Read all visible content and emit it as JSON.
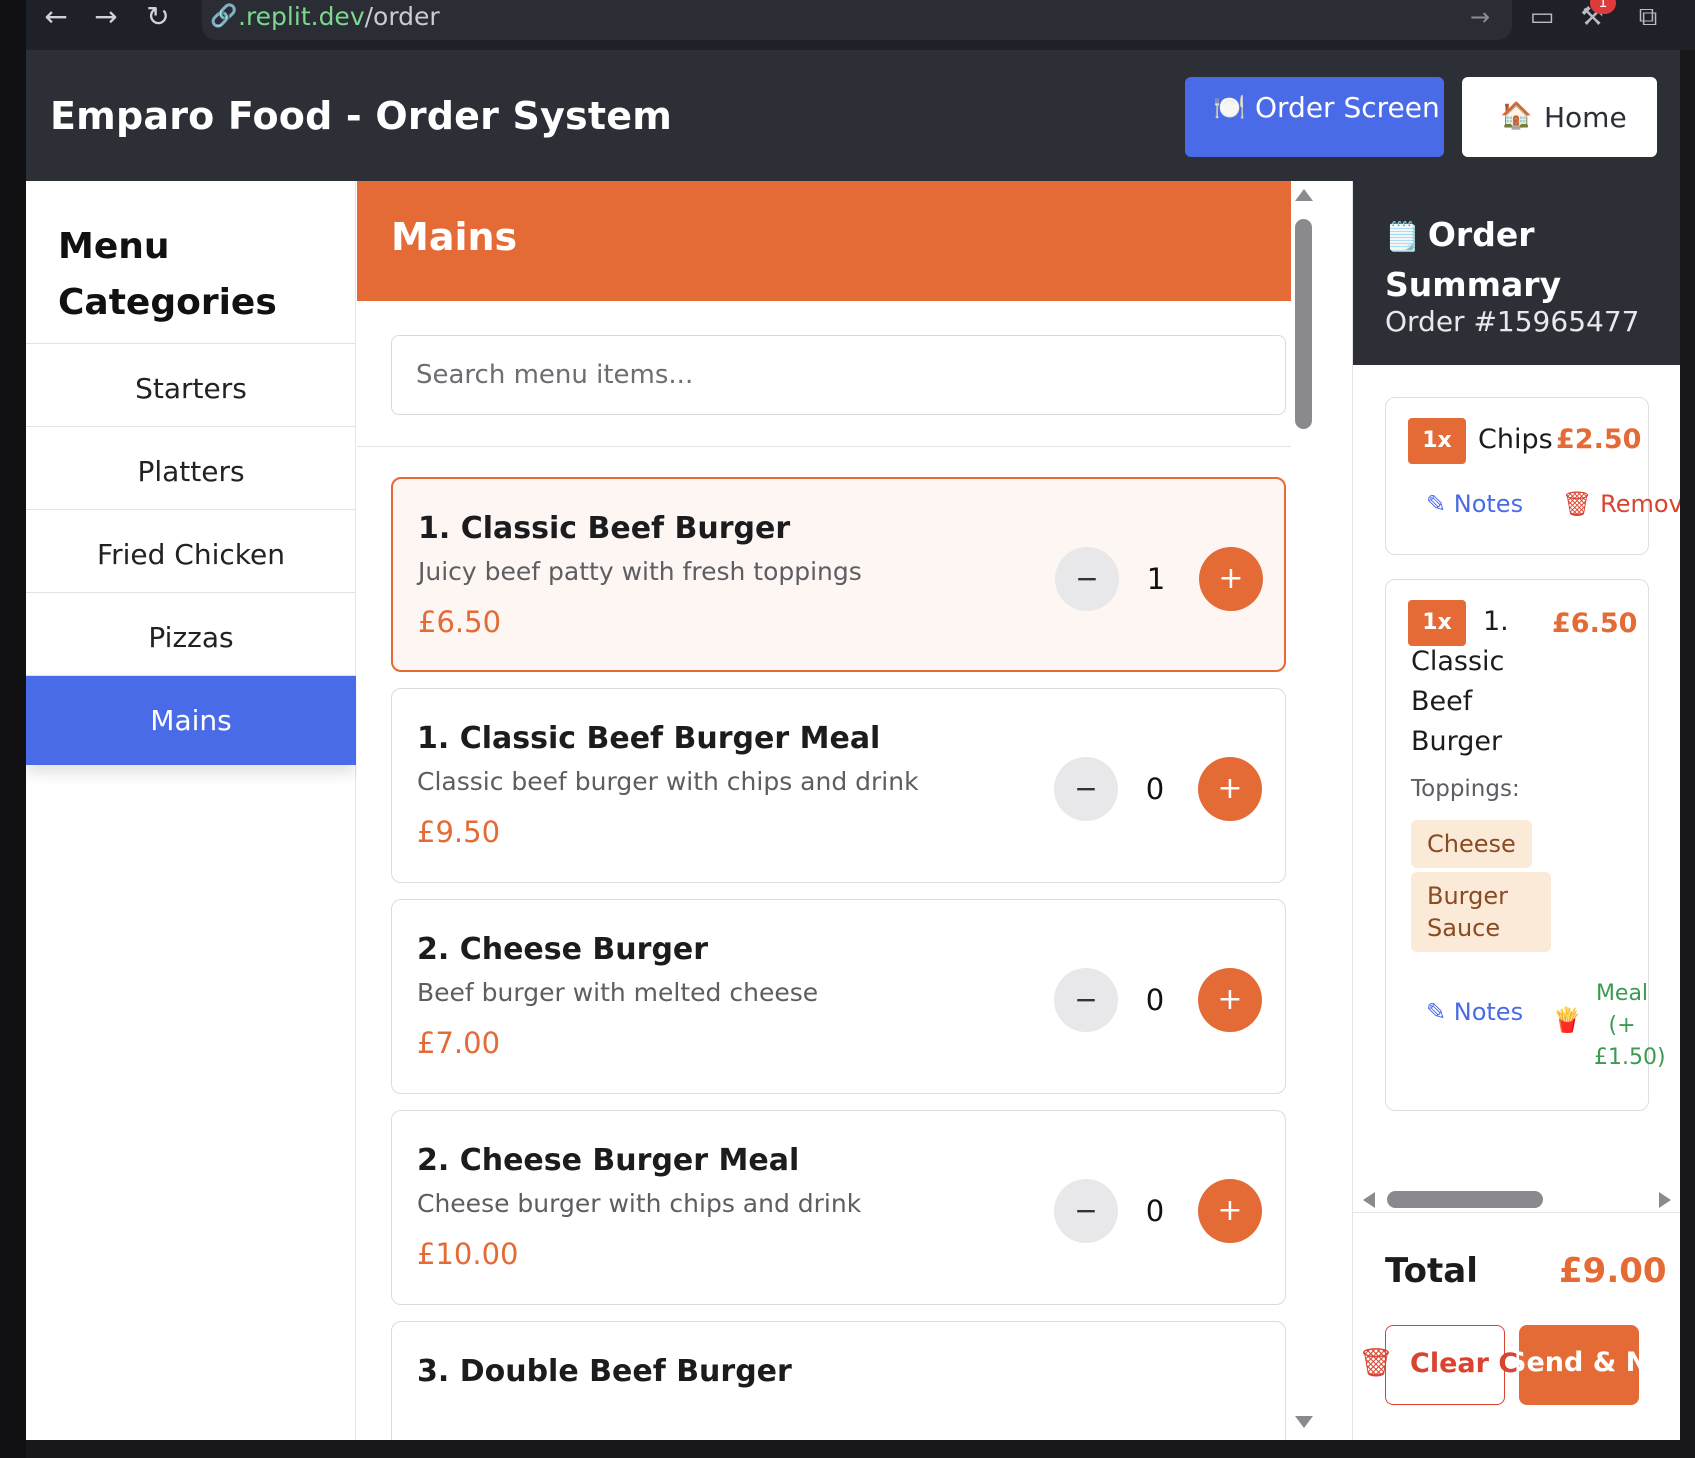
{
  "browser": {
    "url_prefix": ".replit.dev",
    "url_path": "/order",
    "notification_count": "1"
  },
  "header": {
    "title": "Emparo Food - Order System",
    "order_screen_label": "Order Screen",
    "order_screen_icon": "🍽️",
    "home_label": "Home",
    "home_icon": "🏠"
  },
  "sidebar": {
    "heading": "Menu Categories",
    "items": [
      {
        "label": "Starters"
      },
      {
        "label": "Platters"
      },
      {
        "label": "Fried Chicken"
      },
      {
        "label": "Pizzas"
      },
      {
        "label": "Mains",
        "active": true
      }
    ]
  },
  "main": {
    "title": "Mains",
    "search_placeholder": "Search menu items...",
    "items": [
      {
        "name": "1. Classic Beef Burger",
        "desc": "Juicy beef patty with fresh toppings",
        "price": "£6.50",
        "qty": "1",
        "selected": true
      },
      {
        "name": "1. Classic Beef Burger Meal",
        "desc": "Classic beef burger with chips and drink",
        "price": "£9.50",
        "qty": "0"
      },
      {
        "name": "2. Cheese Burger",
        "desc": "Beef burger with melted cheese",
        "price": "£7.00",
        "qty": "0"
      },
      {
        "name": "2. Cheese Burger Meal",
        "desc": "Cheese burger with chips and drink",
        "price": "£10.00",
        "qty": "0"
      },
      {
        "name": "3. Double Beef Burger",
        "desc": "",
        "price": "",
        "qty": ""
      }
    ],
    "minus_symbol": "−",
    "plus_symbol": "+"
  },
  "summary": {
    "title": "Order Summary",
    "title_icon": "🗒️",
    "order_number": "Order #15965477",
    "items": [
      {
        "qty": "1x",
        "name": "Chips",
        "price": "£2.50",
        "notes_label": "Notes",
        "remove_label": "Remove"
      },
      {
        "qty": "1x",
        "name": "1. Classic Beef Burger",
        "price": "£6.50",
        "toppings_label": "Toppings:",
        "toppings": [
          "Cheese",
          "Burger Sauce"
        ],
        "notes_label": "Notes",
        "meal_label": "Meal (+ £1.50)",
        "meal_icon": "🍟"
      }
    ],
    "total_label": "Total",
    "total_value": "£9.00",
    "clear_label": "Clear Cart",
    "send_label": "Send & Next"
  },
  "colors": {
    "accent_orange": "#e46a36",
    "accent_blue": "#4a6be8",
    "header_dark": "#2c2f36",
    "danger_red": "#d9432f",
    "meal_green": "#3c9a52"
  }
}
